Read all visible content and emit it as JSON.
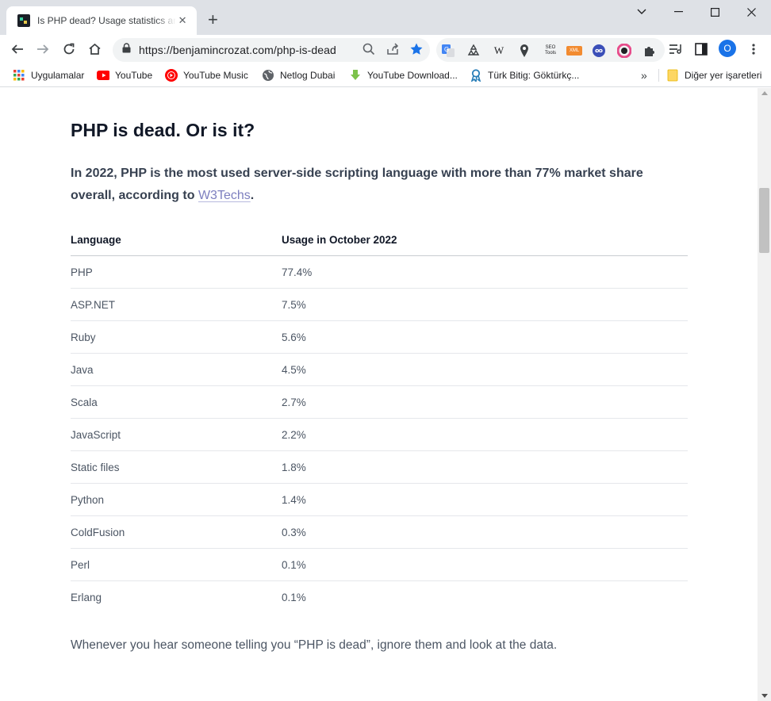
{
  "browser": {
    "tab_title": "Is PHP dead? Usage statistics and",
    "url": "https://benjamincrozat.com/php-is-dead",
    "profile_initial": "O",
    "bookmarks": [
      {
        "label": "Uygulamalar",
        "icon": "apps-grid-icon"
      },
      {
        "label": "YouTube",
        "icon": "youtube-icon"
      },
      {
        "label": "YouTube Music",
        "icon": "youtube-music-icon"
      },
      {
        "label": "Netlog Dubai",
        "icon": "globe-icon"
      },
      {
        "label": "YouTube Download...",
        "icon": "download-arrow-icon"
      },
      {
        "label": "Türk Bitig: Göktürkç...",
        "icon": "ribbon-icon"
      }
    ],
    "other_bookmarks": "Diğer yer işaretleri",
    "extensions": [
      "translate-icon",
      "recycle-icon",
      "wikipedia-icon",
      "map-pin-icon",
      "seo-tools-icon",
      "xml-icon",
      "infinity-icon",
      "color-picker-icon",
      "puzzle-icon"
    ],
    "ext_labels": {
      "wikipedia": "W",
      "seo": "SEO Tools",
      "xml": "XML"
    }
  },
  "article": {
    "heading": "PHP is dead. Or is it?",
    "lead_text": "In 2022, PHP is the most used server-side scripting language with more than 77% market share overall, according to ",
    "lead_link": "W3Techs",
    "lead_end": ".",
    "table": {
      "headers": [
        "Language",
        "Usage in October 2022"
      ],
      "rows": [
        [
          "PHP",
          "77.4%"
        ],
        [
          "ASP.NET",
          "7.5%"
        ],
        [
          "Ruby",
          "5.6%"
        ],
        [
          "Java",
          "4.5%"
        ],
        [
          "Scala",
          "2.7%"
        ],
        [
          "JavaScript",
          "2.2%"
        ],
        [
          "Static files",
          "1.8%"
        ],
        [
          "Python",
          "1.4%"
        ],
        [
          "ColdFusion",
          "0.3%"
        ],
        [
          "Perl",
          "0.1%"
        ],
        [
          "Erlang",
          "0.1%"
        ]
      ]
    },
    "closing": "Whenever you hear someone telling you “PHP is dead”, ignore them and look at the data."
  },
  "colors": {
    "accent": "#1a73e8",
    "link": "#7d7fbf",
    "heading": "#111827"
  }
}
